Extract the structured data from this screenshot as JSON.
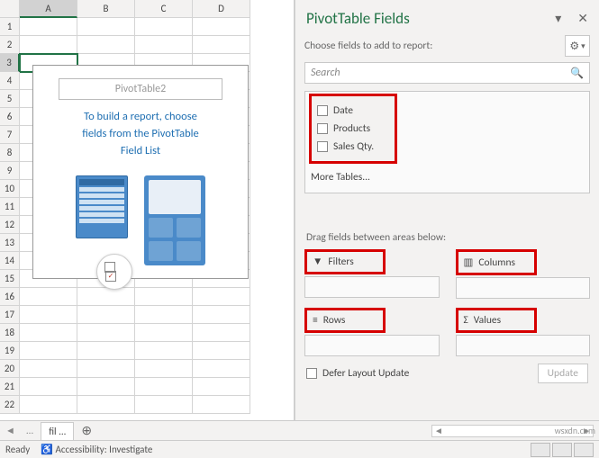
{
  "columns": [
    "A",
    "B",
    "C",
    "D"
  ],
  "rows_visible": 22,
  "selected_cell": {
    "col": "A",
    "row": 3
  },
  "pivot_placeholder": {
    "title": "PivotTable2",
    "message_l1": "To build a report, choose",
    "message_l2": "fields from the PivotTable",
    "message_l3": "Field List"
  },
  "pane": {
    "title": "PivotTable Fields",
    "subtitle": "Choose fields to add to report:",
    "search_placeholder": "Search",
    "fields": [
      "Date",
      "Products",
      "Sales Qty."
    ],
    "more_tables": "More Tables...",
    "areas_label": "Drag fields between areas below:",
    "areas": {
      "filters": "Filters",
      "columns": "Columns",
      "rows": "Rows",
      "values": "Values"
    },
    "defer_label": "Defer Layout Update",
    "update_label": "Update"
  },
  "tabs": {
    "nav_prev": "◄",
    "nav_next": "...",
    "active": "fil ...",
    "add": "⊕"
  },
  "status": {
    "ready": "Ready",
    "access": "Accessibility: Investigate"
  },
  "watermark": "wsxdn.com"
}
